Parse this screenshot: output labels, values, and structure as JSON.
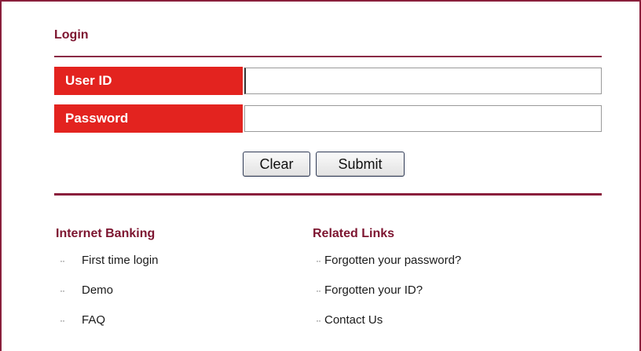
{
  "login": {
    "title": "Login",
    "user_id_label": "User ID",
    "password_label": "Password",
    "user_id_value": "",
    "password_value": "",
    "clear_label": "Clear",
    "submit_label": "Submit"
  },
  "internet_banking": {
    "heading": "Internet Banking",
    "bullet": "··",
    "links": [
      "First time login",
      "Demo",
      "FAQ"
    ]
  },
  "related_links": {
    "heading": "Related Links",
    "bullet": "··",
    "links": [
      "Forgotten your password?",
      "Forgotten your ID?",
      "Contact Us"
    ]
  },
  "colors": {
    "accent_red": "#e3231f",
    "heading_maroon": "#7d1530",
    "rule": "#8a1f3c"
  }
}
